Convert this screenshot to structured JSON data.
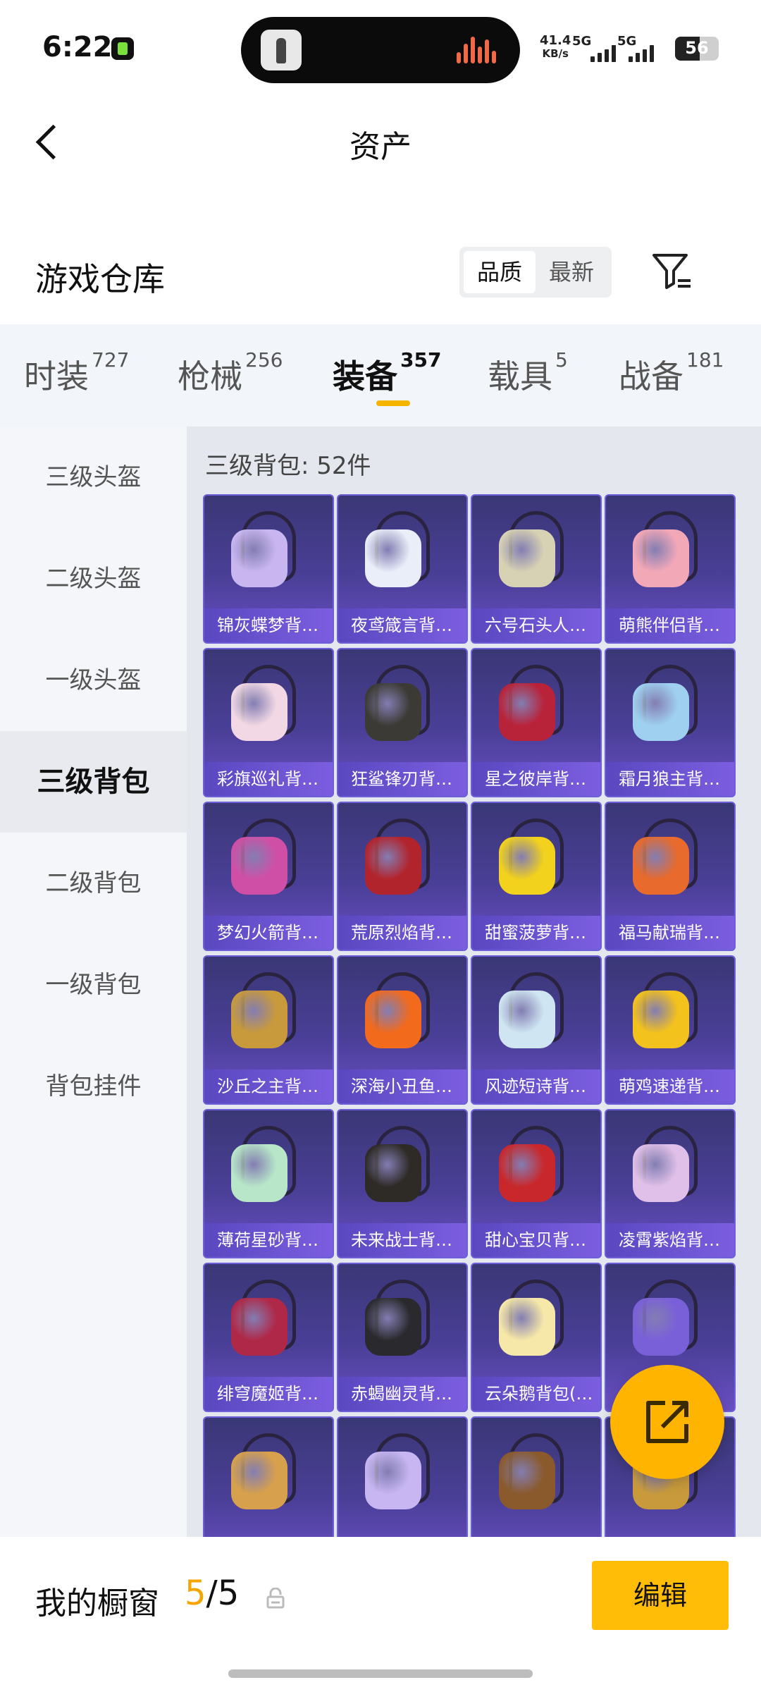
{
  "status_bar": {
    "time": "6:22",
    "net_speed_value": "41.4",
    "net_speed_unit": "KB/s",
    "sim1_type": "5G",
    "sim2_type": "5G",
    "battery": "56",
    "battery_level_percent": 56
  },
  "header": {
    "title": "资产",
    "back_icon": "chevron-left-icon"
  },
  "warehouse": {
    "title": "游戏仓库",
    "sort_options": [
      "品质",
      "最新"
    ],
    "sort_selected": "品质",
    "filter_icon": "filter-icon"
  },
  "tabs": [
    {
      "label": "时装",
      "count": "727",
      "active": false
    },
    {
      "label": "枪械",
      "count": "256",
      "active": false
    },
    {
      "label": "装备",
      "count": "357",
      "active": true
    },
    {
      "label": "载具",
      "count": "5",
      "active": false
    },
    {
      "label": "战备",
      "count": "181",
      "active": false
    }
  ],
  "sidebar": {
    "items": [
      "三级头盔",
      "二级头盔",
      "一级头盔",
      "三级背包",
      "二级背包",
      "一级背包",
      "背包挂件"
    ],
    "active_index": 3
  },
  "content": {
    "section_title": "三级背包: 52件",
    "items": [
      {
        "label": "锦灰蝶梦背…",
        "color": "#c9b6f0"
      },
      {
        "label": "夜鸢箴言背…",
        "color": "#e9eef8"
      },
      {
        "label": "六号石头人…",
        "color": "#d8d2b4"
      },
      {
        "label": "萌熊伴侣背…",
        "color": "#f3a8b8"
      },
      {
        "label": "彩旗巡礼背…",
        "color": "#f1d8e4"
      },
      {
        "label": "狂鲨锋刃背…",
        "color": "#3c3a34"
      },
      {
        "label": "星之彼岸背…",
        "color": "#b8233a"
      },
      {
        "label": "霜月狼主背…",
        "color": "#9fd0f0"
      },
      {
        "label": "梦幻火箭背…",
        "color": "#d04fa6"
      },
      {
        "label": "荒原烈焰背…",
        "color": "#b2242c"
      },
      {
        "label": "甜蜜菠萝背…",
        "color": "#f2d21c"
      },
      {
        "label": "福马献瑞背…",
        "color": "#e86a2c"
      },
      {
        "label": "沙丘之主背…",
        "color": "#c89a3c"
      },
      {
        "label": "深海小丑鱼…",
        "color": "#f26a1c"
      },
      {
        "label": "风迹短诗背…",
        "color": "#cfe6f2"
      },
      {
        "label": "萌鸡速递背…",
        "color": "#f4c21c"
      },
      {
        "label": "薄荷星砂背…",
        "color": "#b8e6c8"
      },
      {
        "label": "未来战士背…",
        "color": "#2e2a26"
      },
      {
        "label": "甜心宝贝背…",
        "color": "#c8282c"
      },
      {
        "label": "凌霄紫焰背…",
        "color": "#e0c0e8"
      },
      {
        "label": "绯穹魔姬背…",
        "color": "#b02848"
      },
      {
        "label": "赤蝎幽灵背…",
        "color": "#2a2a2e"
      },
      {
        "label": "云朵鹅背包(…",
        "color": "#f6e8a8"
      },
      {
        "label": "",
        "color": "#7a60d8"
      },
      {
        "label": "",
        "color": "#d6a04c"
      },
      {
        "label": "",
        "color": "#c8b6f2"
      },
      {
        "label": "",
        "color": "#8a5a2c"
      },
      {
        "label": "",
        "color": "#c89a3c"
      }
    ]
  },
  "fab": {
    "icon": "share-out-icon"
  },
  "bottom_bar": {
    "label": "我的橱窗",
    "count_current": "5",
    "count_sep": "/",
    "count_total": "5",
    "lock_icon": "lock-icon",
    "edit_label": "编辑"
  },
  "colors": {
    "accent": "#f5b400",
    "card_bg": "#4a3f97",
    "card_label_bg": "#6a52d4",
    "sidebar_bg": "#f4f6fa",
    "content_bg": "#e4e8ee"
  }
}
